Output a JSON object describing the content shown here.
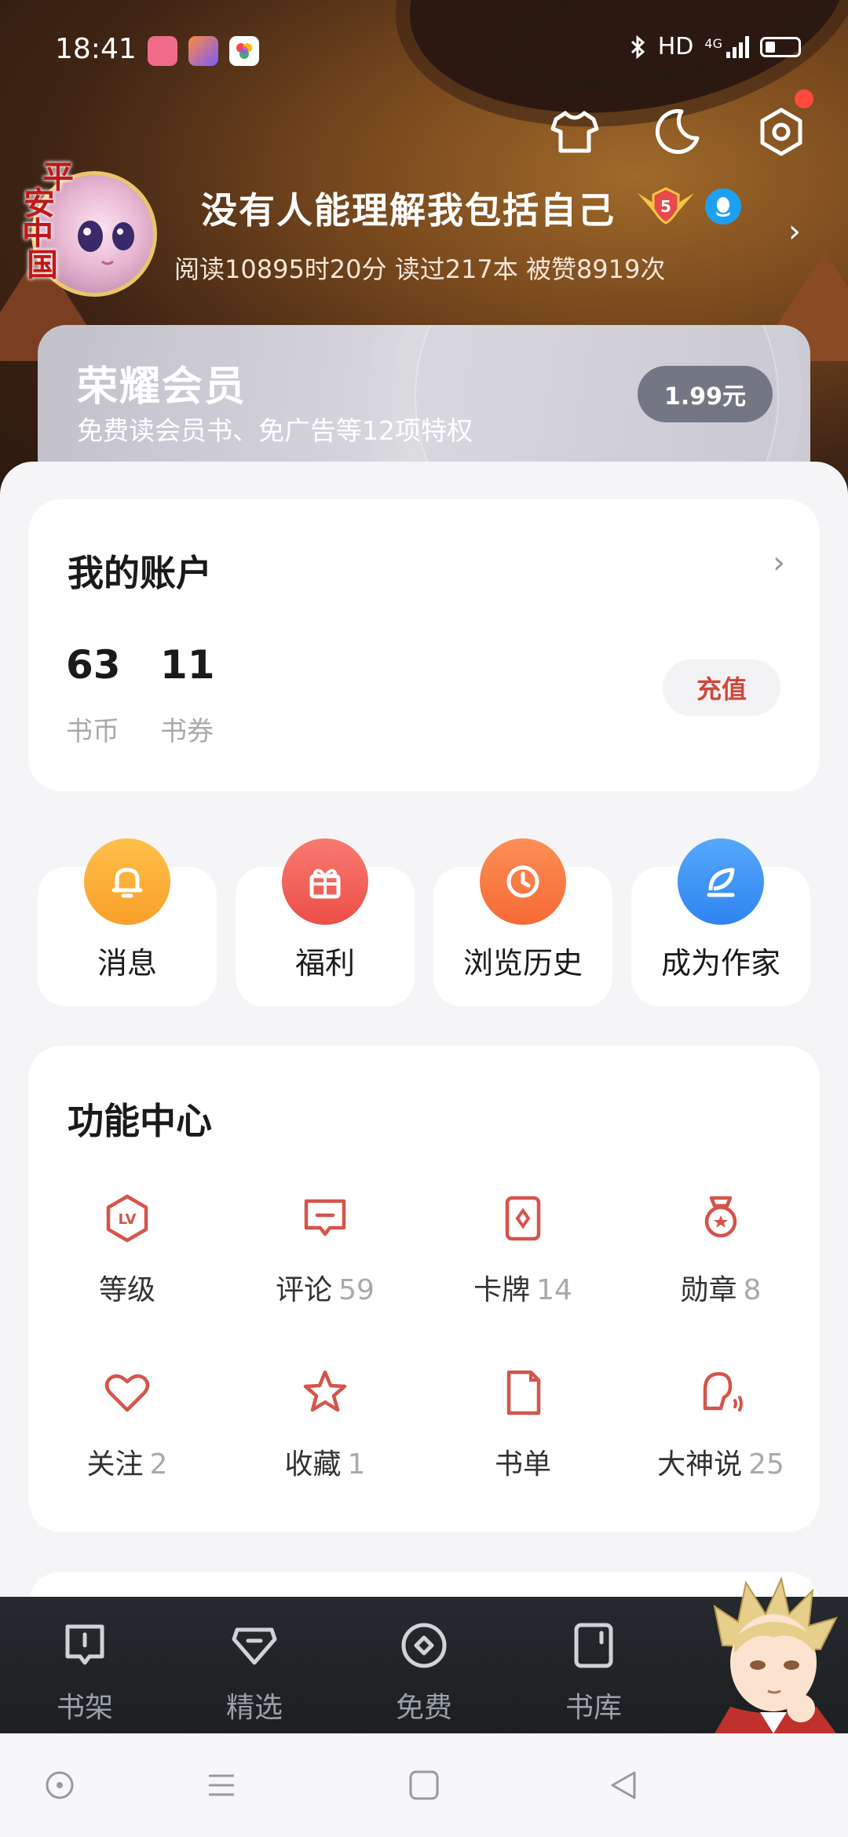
{
  "status_bar": {
    "time": "18:41",
    "hd": "HD",
    "network": "4G"
  },
  "profile": {
    "username": "没有人能理解我包括自己",
    "level": "5",
    "stats": "阅读10895时20分  读过217本  被赞8919次",
    "avatar_frame_text": [
      "平",
      "安",
      "中",
      "国"
    ]
  },
  "vip": {
    "title": "荣耀会员",
    "description": "免费读会员书、免广告等12项特权",
    "price": "1.99元"
  },
  "account": {
    "title": "我的账户",
    "coins_value": "63",
    "coins_label": "书币",
    "vouchers_value": "11",
    "vouchers_label": "书券",
    "recharge": "充值"
  },
  "quick_actions": [
    {
      "label": "消息",
      "icon": "bell-icon",
      "color": "#fbb33a"
    },
    {
      "label": "福利",
      "icon": "gift-icon",
      "color": "#f2615a"
    },
    {
      "label": "浏览历史",
      "icon": "clock-icon",
      "color": "#fb7a45"
    },
    {
      "label": "成为作家",
      "icon": "feather-icon",
      "color": "#3d93f5"
    }
  ],
  "function_center": {
    "title": "功能中心",
    "items": [
      {
        "label": "等级",
        "count": "",
        "icon": "level-icon"
      },
      {
        "label": "评论",
        "count": "59",
        "icon": "comment-icon"
      },
      {
        "label": "卡牌",
        "count": "14",
        "icon": "card-icon"
      },
      {
        "label": "勋章",
        "count": "8",
        "icon": "medal-icon"
      },
      {
        "label": "关注",
        "count": "2",
        "icon": "heart-icon"
      },
      {
        "label": "收藏",
        "count": "1",
        "icon": "star-icon"
      },
      {
        "label": "书单",
        "count": "",
        "icon": "booklist-icon"
      },
      {
        "label": "大神说",
        "count": "25",
        "icon": "speaker-icon"
      }
    ]
  },
  "bottom_nav": [
    {
      "label": "书架",
      "icon": "bookshelf-icon"
    },
    {
      "label": "精选",
      "icon": "diamond-icon"
    },
    {
      "label": "免费",
      "icon": "free-icon"
    },
    {
      "label": "书库",
      "icon": "library-icon"
    }
  ],
  "colors": {
    "accent": "#d0483a",
    "icon_red": "#d5554a",
    "nav_bg": "#1c1f22"
  }
}
